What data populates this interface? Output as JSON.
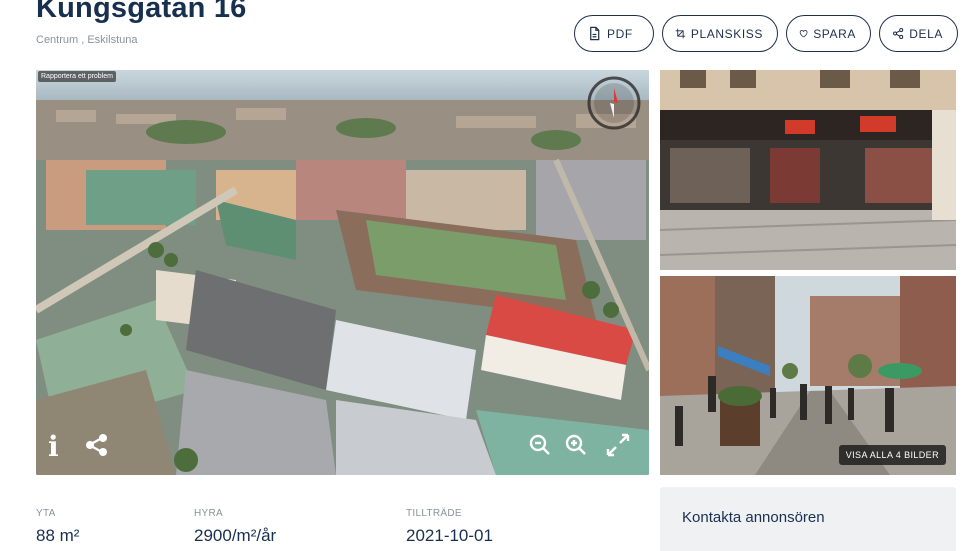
{
  "header": {
    "title": "Kungsgatan 16",
    "subtitle": "Centrum , Eskilstuna"
  },
  "actions": [
    {
      "label": "PDF",
      "icon": "pdf-file-icon"
    },
    {
      "label": "PLANSKISS",
      "icon": "crop-icon"
    },
    {
      "label": "SPARA",
      "icon": "heart-icon"
    },
    {
      "label": "DELA",
      "icon": "share-icon"
    }
  ],
  "main_image": {
    "report_label": "Rapportera ett problem",
    "controls": [
      "info-icon",
      "share-icon",
      "zoom-out-icon",
      "zoom-in-icon",
      "fullscreen-icon",
      "compass-icon"
    ]
  },
  "gallery": {
    "view_all_label": "VISA ALLA 4 BILDER"
  },
  "facts": [
    {
      "label": "YTA",
      "value": "88 m²"
    },
    {
      "label": "HYRA",
      "value": "2900/m²/år"
    },
    {
      "label": "TILLTRÄDE",
      "value": "2021-10-01"
    }
  ],
  "contact": {
    "title": "Kontakta annonsören"
  },
  "colors": {
    "primary": "#18304f",
    "muted": "#8a929c",
    "panel": "#eff1f3"
  }
}
